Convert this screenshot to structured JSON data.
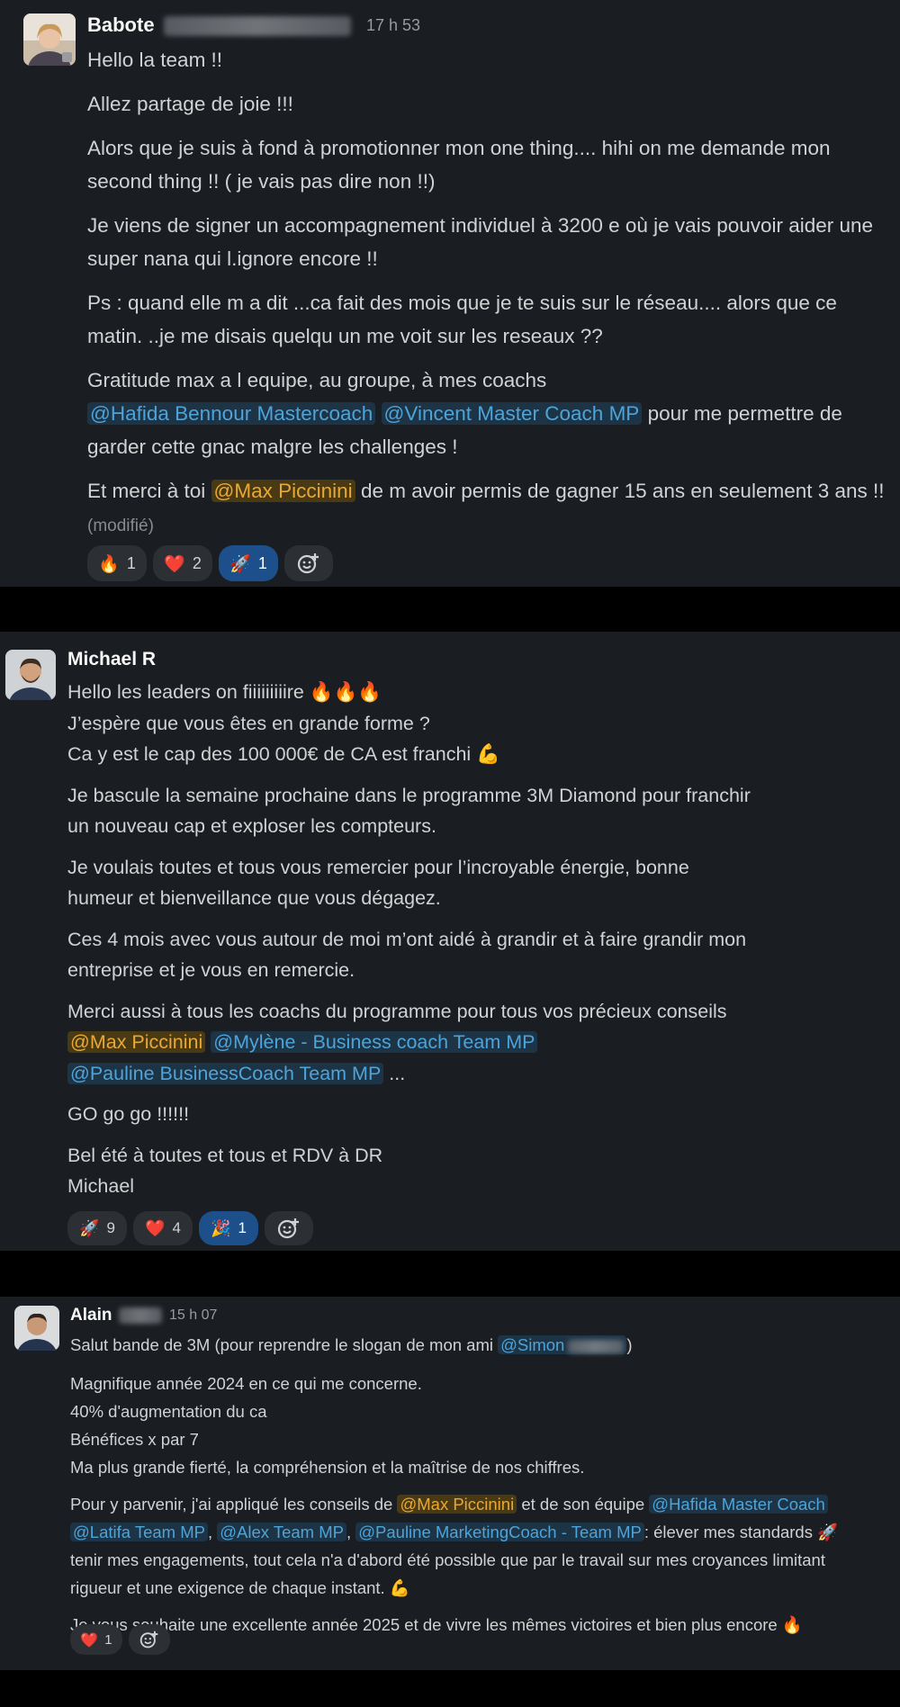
{
  "messages": [
    {
      "author": "Babote",
      "time": "17 h 53",
      "paragraphs": [
        "Hello la team !!",
        "Allez partage de joie !!!",
        "Alors que je suis à fond à promotionner mon one thing.... hihi on me demande mon second thing !! ( je vais pas dire non !!)",
        "Je viens de signer un accompagnement individuel à 3200 e où je vais pouvoir aider une super nana qui l.ignore encore !!",
        "Ps : quand elle m a dit ...ca fait des mois que je te suis sur le réseau.... alors que ce matin. ..je me disais quelqu un me voit sur les reseaux ??"
      ],
      "p6": {
        "a": "Gratitude max a l equipe, au groupe, à mes coachs",
        "mention1": "@Hafida Bennour Mastercoach",
        "mention2": "@Vincent Master Coach MP",
        "b": " pour me permettre de garder cette gnac malgre les challenges !"
      },
      "p7": {
        "a": "Et merci à toi ",
        "mention": "@Max Piccinini",
        "b": " de m avoir permis de gagner 15 ans en seulement 3 ans !! ",
        "edited": "(modifié)"
      },
      "reactions": [
        {
          "emoji": "🔥",
          "count": "1",
          "selected": false
        },
        {
          "emoji": "❤️",
          "count": "2",
          "selected": false
        },
        {
          "emoji": "🚀",
          "count": "1",
          "selected": true
        }
      ]
    },
    {
      "author": "Michael R",
      "lines1": [
        "Hello les leaders on fiiiiiiiiire 🔥🔥🔥",
        "J’espère que vous êtes en grande forme ?",
        "Ca y est le cap des 100 000€ de CA est franchi 💪"
      ],
      "paragraphs": [
        "Je bascule la semaine prochaine dans le programme 3M Diamond pour franchir un nouveau cap et exploser les compteurs.",
        "Je voulais toutes et tous vous remercier pour l’incroyable énergie, bonne humeur et bienveillance que vous dégagez.",
        "Ces 4 mois avec vous autour de moi m’ont aidé à grandir et à faire grandir mon entreprise et je vous en remercie."
      ],
      "p5": {
        "a": "Merci aussi à tous les coachs du programme pour tous vos précieux conseils",
        "mention1": "@Max Piccinini",
        "mention2": "@Mylène - Business coach Team MP",
        "mention3": "@Pauline BusinessCoach Team MP",
        "ellipsis": "..."
      },
      "p6": "GO go go !!!!!!",
      "p7": [
        "Bel été à toutes et tous et RDV à DR",
        "Michael"
      ],
      "reactions": [
        {
          "emoji": "🚀",
          "count": "9",
          "selected": false
        },
        {
          "emoji": "❤️",
          "count": "4",
          "selected": false
        },
        {
          "emoji": "🎉",
          "count": "1",
          "selected": true
        }
      ]
    },
    {
      "author": "Alain",
      "time": "15 h 07",
      "first": {
        "a": "Salut bande de 3M (pour reprendre le slogan de mon ami ",
        "mention": "@Simon",
        "b": ")"
      },
      "lines": [
        "Magnifique année 2024 en ce qui me concerne.",
        "40% d'augmentation du ca",
        "Bénéfices x par 7",
        "Ma plus grande fierté, la compréhension et la maîtrise de nos chiffres."
      ],
      "p3": {
        "a": "Pour y parvenir, j'ai appliqué les conseils de ",
        "mention1": "@Max Piccinini",
        "b": " et de son équipe ",
        "mention2": "@Hafida Master Coach",
        "mention3": "@Latifa Team MP",
        "mention4": "@Alex Team MP",
        "mention5": "@Pauline MarketingCoach - Team MP",
        "c": ": élever mes standards 🚀",
        "d": "tenir mes engagements, tout cela n'a d'abord été possible que par le travail sur mes croyances limitant",
        "e": "rigueur et une exigence de chaque instant. 💪"
      },
      "last": "Je vous souhaite une excellente année 2025 et de vivre les mêmes victoires et bien plus encore 🔥",
      "reactions": [
        {
          "emoji": "❤️",
          "count": "1",
          "selected": false
        }
      ]
    }
  ],
  "add_reaction_icon": "smiley-plus",
  "colors": {
    "background": "#1a1d21",
    "mention_blue": "#4ea3d8",
    "mention_yellow": "#e8a838",
    "selected_reaction": "#1d4f8a"
  }
}
